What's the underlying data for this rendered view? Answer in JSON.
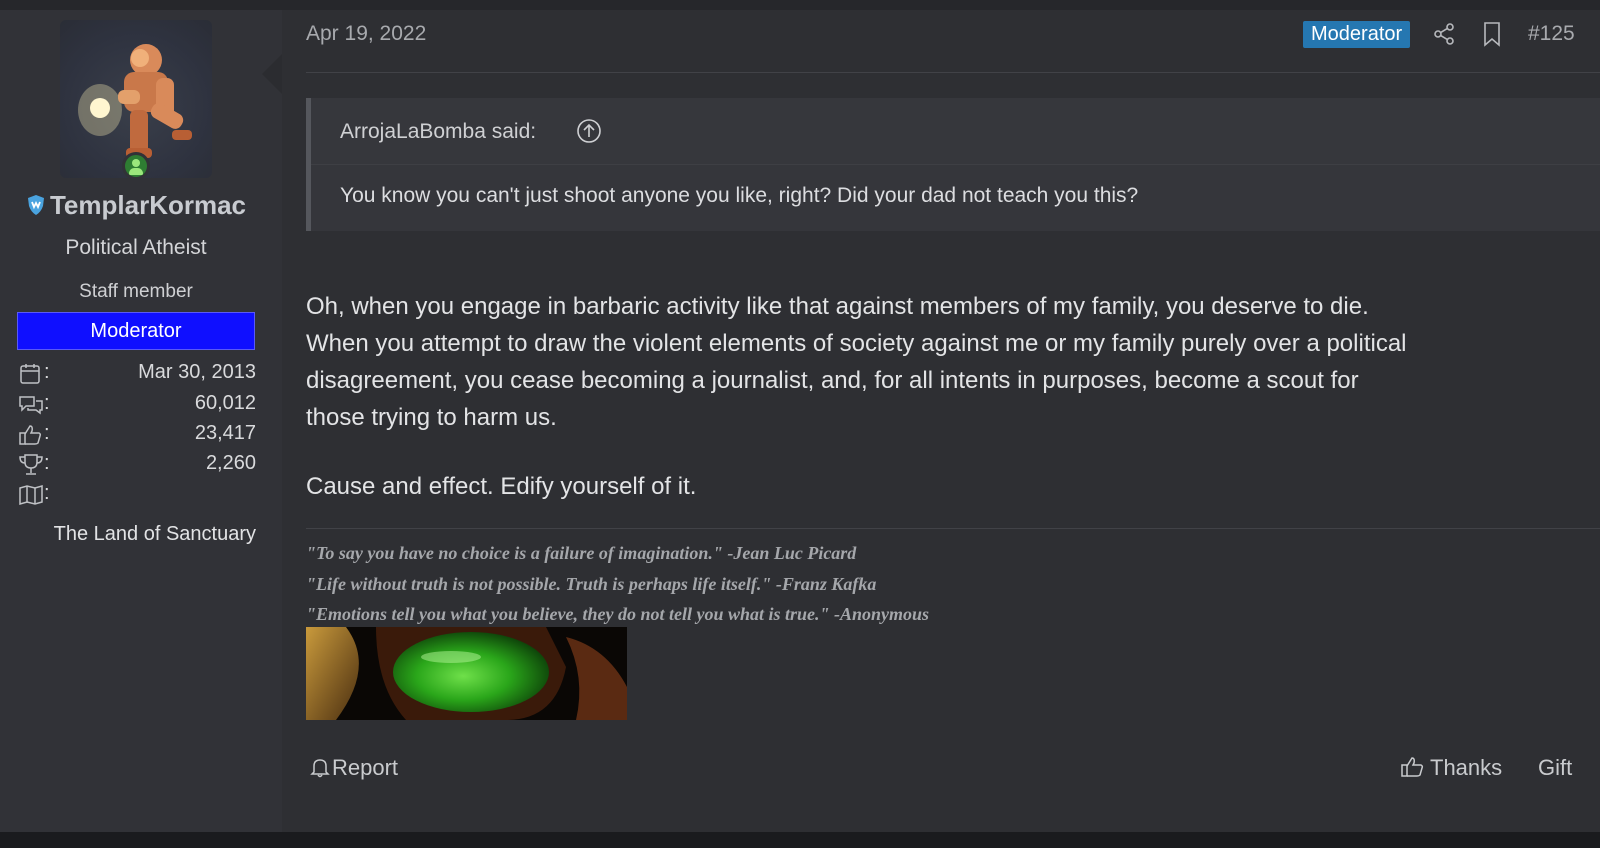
{
  "user": {
    "name": "TemplarKormac",
    "title": "Political Atheist",
    "staff_label": "Staff member",
    "banner": "Moderator",
    "stats": [
      {
        "icon": "calendar-icon",
        "colon": ":",
        "value": "Mar 30, 2013"
      },
      {
        "icon": "messages-icon",
        "colon": ":",
        "value": "60,012"
      },
      {
        "icon": "thumbs-up-icon",
        "colon": ":",
        "value": "23,417"
      },
      {
        "icon": "trophy-icon",
        "colon": ":",
        "value": "2,260"
      },
      {
        "icon": "map-icon",
        "colon": ":",
        "value": ""
      }
    ],
    "location": "The Land of Sanctuary"
  },
  "post": {
    "date": "Apr 19, 2022",
    "badge": "Moderator",
    "number": "#125",
    "quote": {
      "author": "ArrojaLaBomba said:",
      "text": "You know you can't just shoot anyone you like, right? Did your dad not teach you this?"
    },
    "message_lines": [
      "Oh, when you engage in barbaric activity like that against members of my family, you deserve to die.",
      "When you attempt to draw the violent elements of society against me or my family purely over a political",
      "disagreement, you cease becoming a journalist, and, for all intents in purposes, become a scout for",
      "those trying to harm us."
    ],
    "closing": "Cause and effect. Edify yourself of it.",
    "signature": [
      "\"To say you have no choice is a failure of imagination.\" -Jean Luc Picard",
      "\"Life without truth is not possible. Truth is perhaps life itself.\" -Franz Kafka",
      "\"Emotions tell you what you believe, they do not tell you what is true.\" -Anonymous"
    ]
  },
  "actions": {
    "report": "Report",
    "thanks": "Thanks",
    "gift": "Gift"
  },
  "colors": {
    "moderator_banner": "#0f0fff",
    "moderator_badge": "#2577b1",
    "online": "#2e7d32"
  }
}
